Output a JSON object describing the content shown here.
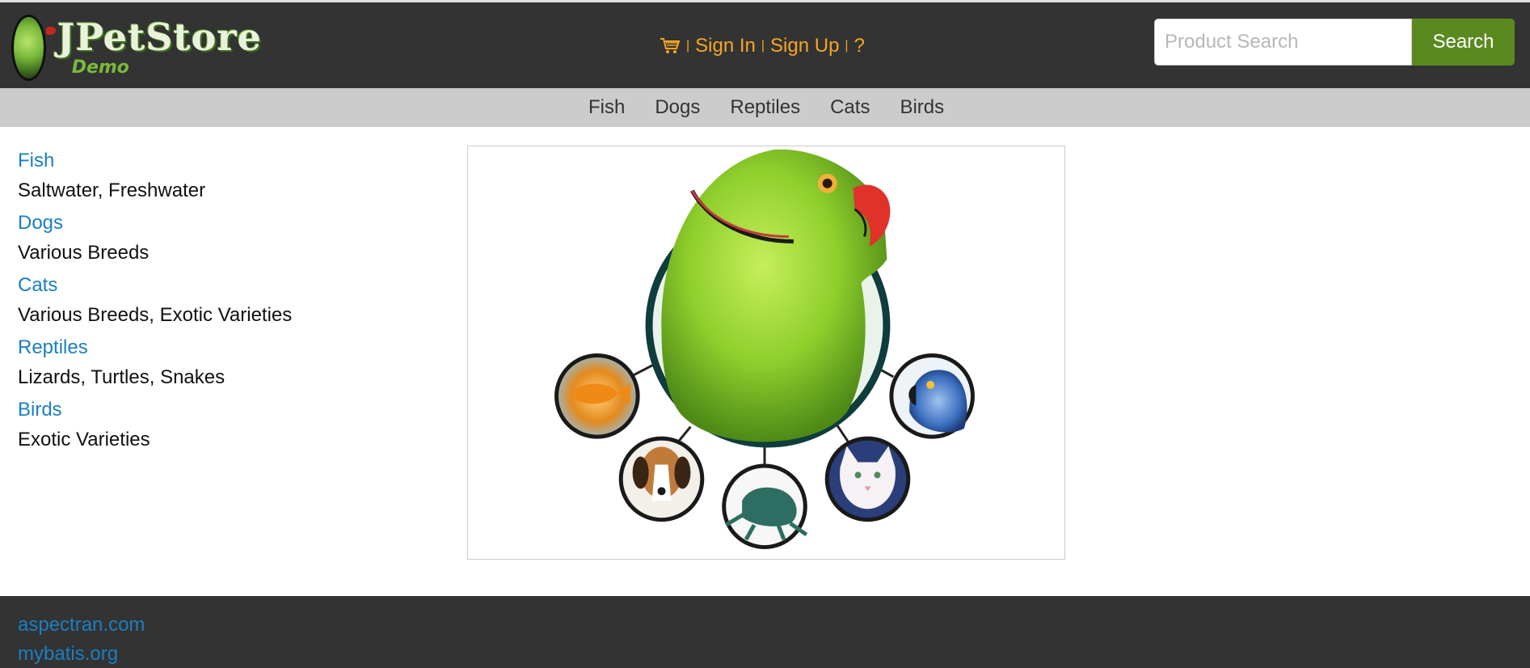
{
  "header": {
    "logo_title": "JPetStore",
    "logo_subtitle": "Demo",
    "cart_icon": "cart-icon",
    "sign_in": "Sign In",
    "sign_up": "Sign Up",
    "help": "?",
    "separator": "|",
    "search_placeholder": "Product Search",
    "search_button": "Search"
  },
  "categories_bar": [
    "Fish",
    "Dogs",
    "Reptiles",
    "Cats",
    "Birds"
  ],
  "sidebar": [
    {
      "label": "Fish",
      "description": "Saltwater, Freshwater"
    },
    {
      "label": "Dogs",
      "description": "Various Breeds"
    },
    {
      "label": "Cats",
      "description": "Various Breeds, Exotic Varieties"
    },
    {
      "label": "Reptiles",
      "description": "Lizards, Turtles, Snakes"
    },
    {
      "label": "Birds",
      "description": "Exotic Varieties"
    }
  ],
  "footer": {
    "links": [
      "aspectran.com",
      "mybatis.org"
    ]
  },
  "colors": {
    "header_bg": "#333333",
    "link_orange": "#f5a623",
    "link_blue": "#1a7fc1",
    "search_button": "#5a8a1f",
    "category_bar_bg": "#cccccc"
  }
}
